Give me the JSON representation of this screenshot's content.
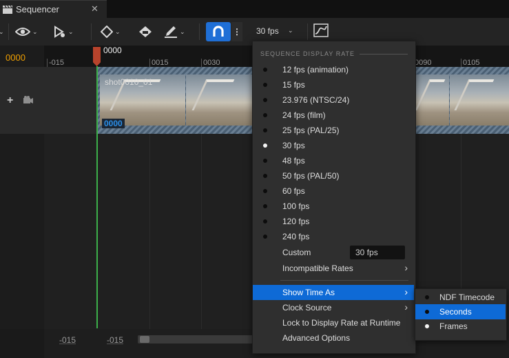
{
  "tab": {
    "title": "Sequencer",
    "close": "✕"
  },
  "toolbar": {
    "fps_label": "30 fps",
    "chevron": "⌄",
    "more": "⋮"
  },
  "timeline": {
    "current_time": "0000",
    "playhead_label": "0000",
    "ruler_labels": [
      "-015",
      "0015",
      "0030",
      "0090",
      "0105"
    ],
    "add": "+",
    "bottom_start": "-015",
    "bottom_end": "-015"
  },
  "shot": {
    "name": "shot0010_01",
    "frame": "0000"
  },
  "menu": {
    "heading": "SEQUENCE DISPLAY RATE",
    "rates": [
      {
        "label": "12 fps (animation)",
        "selected": false
      },
      {
        "label": "15 fps",
        "selected": false
      },
      {
        "label": "23.976 (NTSC/24)",
        "selected": false
      },
      {
        "label": "24 fps (film)",
        "selected": false
      },
      {
        "label": "25 fps (PAL/25)",
        "selected": false
      },
      {
        "label": "30 fps",
        "selected": true
      },
      {
        "label": "48 fps",
        "selected": false
      },
      {
        "label": "50 fps (PAL/50)",
        "selected": false
      },
      {
        "label": "60 fps",
        "selected": false
      },
      {
        "label": "100 fps",
        "selected": false
      },
      {
        "label": "120 fps",
        "selected": false
      },
      {
        "label": "240 fps",
        "selected": false
      }
    ],
    "custom_label": "Custom",
    "custom_value": "30 fps",
    "incompatible_label": "Incompatible Rates",
    "show_time_as": "Show Time As",
    "clock_source": "Clock Source",
    "lock_rate": "Lock to Display Rate at Runtime",
    "advanced": "Advanced Options",
    "arrow": "›"
  },
  "submenu": {
    "items": [
      {
        "label": "NDF Timecode",
        "selected": false
      },
      {
        "label": "Seconds",
        "selected": false
      },
      {
        "label": "Frames",
        "selected": true
      }
    ]
  },
  "colors": {
    "accent": "#0e6ad6",
    "playhead": "#b8432c",
    "playhead_line": "#3cb04a",
    "time_readout": "#f0a000"
  }
}
